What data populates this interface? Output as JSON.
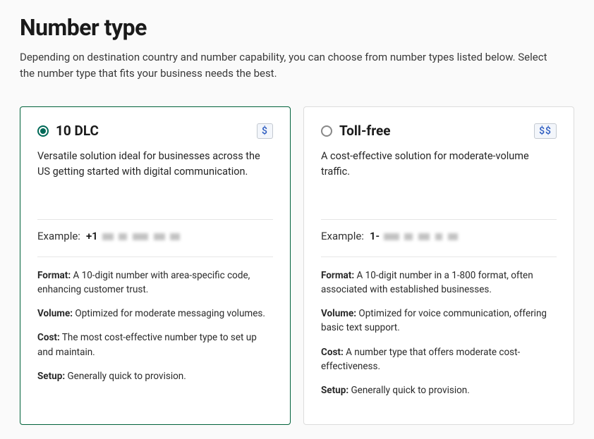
{
  "header": {
    "title": "Number type",
    "subtitle": "Depending on destination country and number capability, you can choose from number types listed below. Select the number type that fits your business needs the best."
  },
  "example_label": "Example:",
  "cards": [
    {
      "id": "10dlc",
      "selected": true,
      "title": "10 DLC",
      "price_badge": "$",
      "description": "Versatile solution ideal for businesses across the US getting started with digital communication.",
      "example_prefix": "+1",
      "details": {
        "format_label": "Format:",
        "format_text": " A 10-digit number with area-specific code, enhancing customer trust.",
        "volume_label": "Volume:",
        "volume_text": " Optimized for moderate messaging volumes.",
        "cost_label": "Cost:",
        "cost_text": " The most cost-effective number type to set up and maintain.",
        "setup_label": "Setup:",
        "setup_text": " Generally quick to provision."
      }
    },
    {
      "id": "tollfree",
      "selected": false,
      "title": "Toll-free",
      "price_badge": "$$",
      "description": "A cost-effective solution for moderate-volume traffic.",
      "example_prefix": "1-",
      "details": {
        "format_label": "Format:",
        "format_text": " A 10-digit number in a 1-800 format, often associated with established businesses.",
        "volume_label": "Volume:",
        "volume_text": " Optimized for voice communication, offering basic text support.",
        "cost_label": "Cost:",
        "cost_text": " A number type that offers moderate cost-effectiveness.",
        "setup_label": "Setup:",
        "setup_text": " Generally quick to provision."
      }
    }
  ]
}
